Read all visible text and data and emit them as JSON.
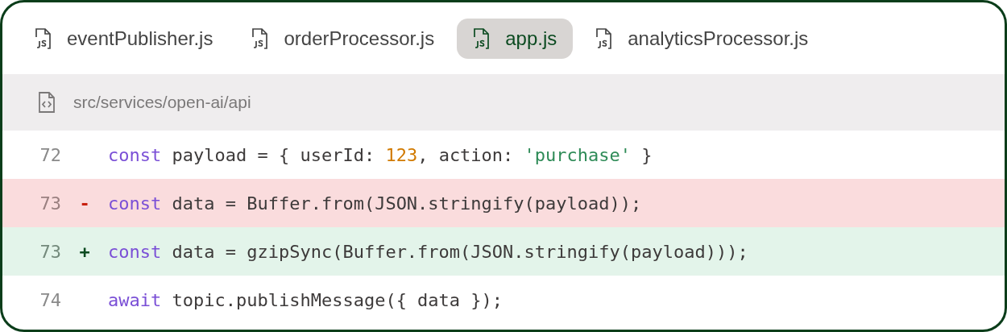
{
  "tabs": [
    {
      "label": "eventPublisher.js",
      "selected": false
    },
    {
      "label": "orderProcessor.js",
      "selected": false
    },
    {
      "label": "app.js",
      "selected": true
    },
    {
      "label": "analyticsProcessor.js",
      "selected": false
    }
  ],
  "path": "src/services/open-ai/api",
  "lines": [
    {
      "number": "72",
      "kind": "context",
      "tokens": [
        {
          "kind": "keyword",
          "text": "const"
        },
        {
          "kind": "plain",
          "text": " payload = { userId: "
        },
        {
          "kind": "number",
          "text": "123"
        },
        {
          "kind": "plain",
          "text": ", action: "
        },
        {
          "kind": "string",
          "text": "'purchase'"
        },
        {
          "kind": "plain",
          "text": " }"
        }
      ]
    },
    {
      "number": "73",
      "kind": "removed",
      "marker": "-",
      "tokens": [
        {
          "kind": "keyword",
          "text": "const"
        },
        {
          "kind": "plain",
          "text": " data = Buffer.from(JSON.stringify(payload));"
        }
      ]
    },
    {
      "number": "73",
      "kind": "added",
      "marker": "+",
      "tokens": [
        {
          "kind": "keyword",
          "text": "const"
        },
        {
          "kind": "plain",
          "text": " data = gzipSync(Buffer.from(JSON.stringify(payload)));"
        }
      ]
    },
    {
      "number": "74",
      "kind": "context",
      "tokens": [
        {
          "kind": "keyword",
          "text": "await"
        },
        {
          "kind": "plain",
          "text": " topic.publishMessage({ data });"
        }
      ]
    }
  ]
}
